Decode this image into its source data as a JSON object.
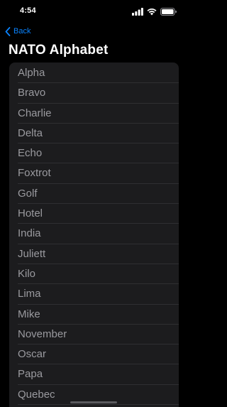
{
  "status_bar": {
    "time": "4:54",
    "icons": [
      "cellular-signal-icon",
      "wifi-icon",
      "battery-icon"
    ]
  },
  "nav": {
    "back_label": "Back",
    "back_icon": "chevron-left-icon",
    "title": "NATO Alphabet"
  },
  "list": {
    "items": [
      "Alpha",
      "Bravo",
      "Charlie",
      "Delta",
      "Echo",
      "Foxtrot",
      "Golf",
      "Hotel",
      "India",
      "Juliett",
      "Kilo",
      "Lima",
      "Mike",
      "November",
      "Oscar",
      "Papa",
      "Quebec"
    ]
  },
  "colors": {
    "background": "#000000",
    "card": "#1c1c1e",
    "text_secondary": "#9a9a9f",
    "accent": "#0a84ff"
  }
}
